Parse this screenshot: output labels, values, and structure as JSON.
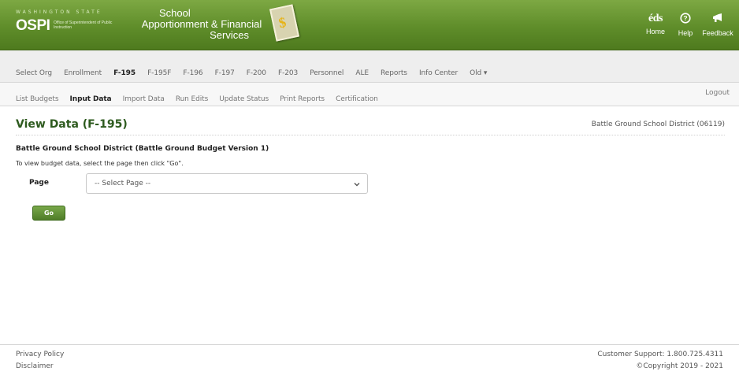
{
  "header": {
    "state_label": "WASHINGTON STATE",
    "logo_text": "OSPI",
    "office_text": "Office of Superintendent of Public Instruction",
    "app_title_line1": "School",
    "app_title_line2": "Apportionment & Financial",
    "app_title_line3": "Services",
    "home_icon_text": "éds",
    "home_label": "Home",
    "help_icon": "help-circle-icon",
    "help_label": "Help",
    "feedback_icon": "megaphone-icon",
    "feedback_label": "Feedback",
    "brand_color": "#5f8d2a"
  },
  "nav_primary": {
    "items": [
      {
        "label": "Select Org"
      },
      {
        "label": "Enrollment"
      },
      {
        "label": "F-195",
        "active": true
      },
      {
        "label": "F-195F"
      },
      {
        "label": "F-196"
      },
      {
        "label": "F-197"
      },
      {
        "label": "F-200"
      },
      {
        "label": "F-203"
      },
      {
        "label": "Personnel"
      },
      {
        "label": "ALE"
      },
      {
        "label": "Reports"
      },
      {
        "label": "Info Center"
      },
      {
        "label": "Old ▾"
      }
    ]
  },
  "nav_secondary": {
    "items": [
      {
        "label": "List Budgets"
      },
      {
        "label": "Input Data",
        "active": true
      },
      {
        "label": "Import Data"
      },
      {
        "label": "Run Edits"
      },
      {
        "label": "Update Status"
      },
      {
        "label": "Print Reports"
      },
      {
        "label": "Certification"
      }
    ],
    "logout_label": "Logout"
  },
  "content": {
    "page_title": "View Data (F-195)",
    "district_tag": "Battle Ground School District (06119)",
    "budget_title": "Battle Ground School District (Battle Ground Budget Version 1)",
    "instructions": "To view budget data, select the page then click \"Go\".",
    "page_label": "Page",
    "page_select_value": "-- Select Page --",
    "go_label": "Go"
  },
  "footer": {
    "privacy_label": "Privacy Policy",
    "disclaimer_label": "Disclaimer",
    "support_text": "Customer Support: 1.800.725.4311",
    "copyright_text": "©Copyright 2019 - 2021"
  }
}
